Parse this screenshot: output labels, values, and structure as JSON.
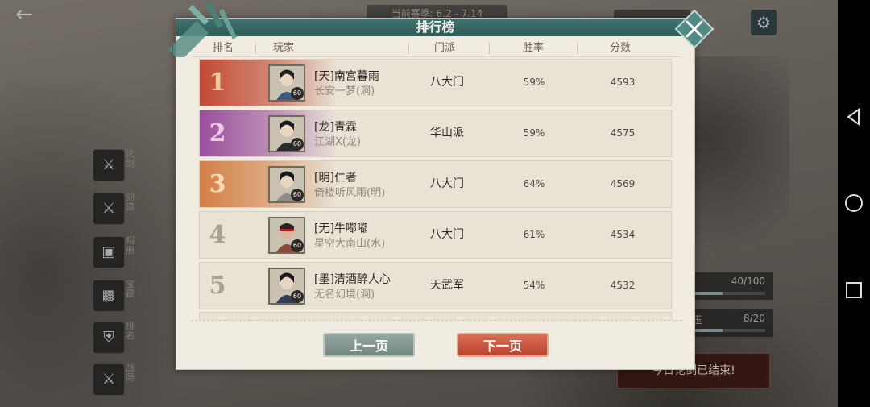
{
  "modal": {
    "title": "排行榜",
    "columns": {
      "rank": "排名",
      "player": "玩家",
      "sect": "门派",
      "win_rate": "胜率",
      "score": "分数"
    },
    "rows": [
      {
        "rank": "1",
        "name": "[天]南宫暮雨",
        "server": "长安一梦(洞)",
        "level": "60",
        "sect": "八大门",
        "win_rate": "59%",
        "score": "4593"
      },
      {
        "rank": "2",
        "name": "[龙]青霖",
        "server": "江湖X(龙)",
        "level": "60",
        "sect": "华山派",
        "win_rate": "59%",
        "score": "4575"
      },
      {
        "rank": "3",
        "name": "[明]仁者",
        "server": "倚楼听风雨(明)",
        "level": "60",
        "sect": "八大门",
        "win_rate": "64%",
        "score": "4569"
      },
      {
        "rank": "4",
        "name": "[无]牛嘟嘟",
        "server": "星空大南山(水)",
        "level": "60",
        "sect": "八大门",
        "win_rate": "61%",
        "score": "4534"
      },
      {
        "rank": "5",
        "name": "[墨]清酒醉人心",
        "server": "无名幻境(洞)",
        "level": "60",
        "sect": "天武军",
        "win_rate": "54%",
        "score": "4532"
      }
    ],
    "prev_label": "上一页",
    "next_label": "下一页",
    "close_icon": "close-icon"
  },
  "background": {
    "season_text": "当前赛季: 6.2 - 7.14",
    "progress_1": {
      "value": "40/100",
      "fraction": 0.4
    },
    "progress_2": {
      "label": "玉",
      "value": "8/20",
      "fraction": 0.4
    },
    "ended_text": "今日论剑已结束!",
    "side_labels": [
      "论剑",
      "剑谱",
      "相册",
      "宝藏",
      "排名",
      "战局"
    ]
  },
  "colors": {
    "header_teal": "#3e7470",
    "panel_bg": "#f1ece1",
    "rank1": "#c24b34",
    "rank2": "#9a4f9e",
    "rank3": "#d47f46",
    "next_button": "#c9533b",
    "prev_button": "#879893"
  }
}
